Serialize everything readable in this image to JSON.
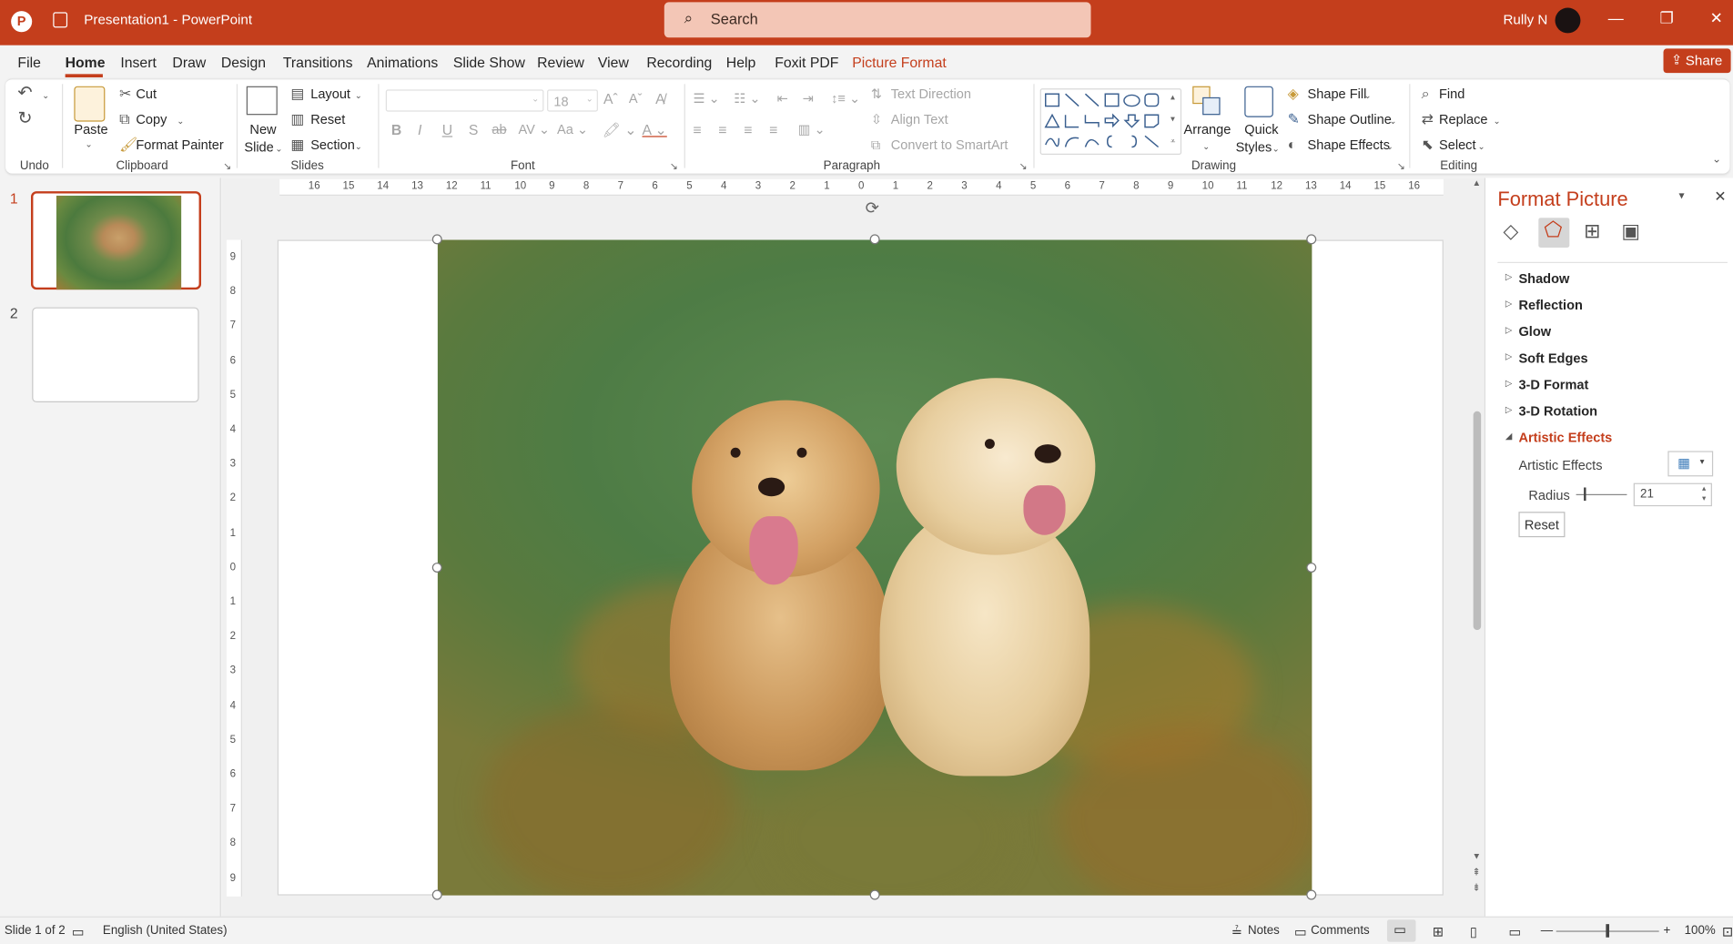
{
  "app": {
    "title": "Presentation1  -  PowerPoint",
    "user": "Rully N"
  },
  "search": {
    "placeholder": "Search"
  },
  "menu": [
    "File",
    "Home",
    "Insert",
    "Draw",
    "Design",
    "Transitions",
    "Animations",
    "Slide Show",
    "Review",
    "View",
    "Recording",
    "Help",
    "Foxit PDF",
    "Picture Format"
  ],
  "share_label": "Share",
  "ribbon": {
    "undo": {
      "label": "Undo"
    },
    "clipboard": {
      "paste": "Paste",
      "cut": "Cut",
      "copy": "Copy",
      "format_painter": "Format Painter",
      "label": "Clipboard"
    },
    "slides": {
      "new_slide_1": "New",
      "new_slide_2": "Slide",
      "layout": "Layout",
      "reset": "Reset",
      "section": "Section",
      "label": "Slides"
    },
    "font": {
      "font_size": "18",
      "label": "Font"
    },
    "paragraph": {
      "text_direction": "Text Direction",
      "align_text": "Align Text",
      "convert_smartart": "Convert to SmartArt",
      "label": "Paragraph"
    },
    "drawing": {
      "arrange": "Arrange",
      "quick_styles_1": "Quick",
      "quick_styles_2": "Styles",
      "shape_fill": "Shape Fill",
      "shape_outline": "Shape Outline",
      "shape_effects": "Shape Effects",
      "label": "Drawing"
    },
    "editing": {
      "find": "Find",
      "replace": "Replace",
      "select": "Select",
      "label": "Editing"
    }
  },
  "thumbnails": [
    "1",
    "2"
  ],
  "rulers": {
    "horizontal": [
      "16",
      "15",
      "14",
      "13",
      "12",
      "11",
      "10",
      "9",
      "8",
      "7",
      "6",
      "5",
      "4",
      "3",
      "2",
      "1",
      "0",
      "1",
      "2",
      "3",
      "4",
      "5",
      "6",
      "7",
      "8",
      "9",
      "10",
      "11",
      "12",
      "13",
      "14",
      "15",
      "16"
    ],
    "vertical": [
      "9",
      "8",
      "7",
      "6",
      "5",
      "4",
      "3",
      "2",
      "1",
      "0",
      "1",
      "2",
      "3",
      "4",
      "5",
      "6",
      "7",
      "8",
      "9"
    ]
  },
  "format_pane": {
    "title": "Format Picture",
    "sections": [
      "Shadow",
      "Reflection",
      "Glow",
      "Soft Edges",
      "3-D Format",
      "3-D Rotation"
    ],
    "expanded": "Artistic Effects",
    "artistic_effects_label": "Artistic Effects",
    "radius_label": "Radius",
    "radius_value": "21",
    "reset_label": "Reset"
  },
  "status": {
    "slide": "Slide 1 of 2",
    "language": "English (United States)",
    "notes": "Notes",
    "comments": "Comments",
    "zoom": "100%"
  },
  "colors": {
    "accent": "#c43e1c",
    "pane_title": "#c43e1c"
  }
}
